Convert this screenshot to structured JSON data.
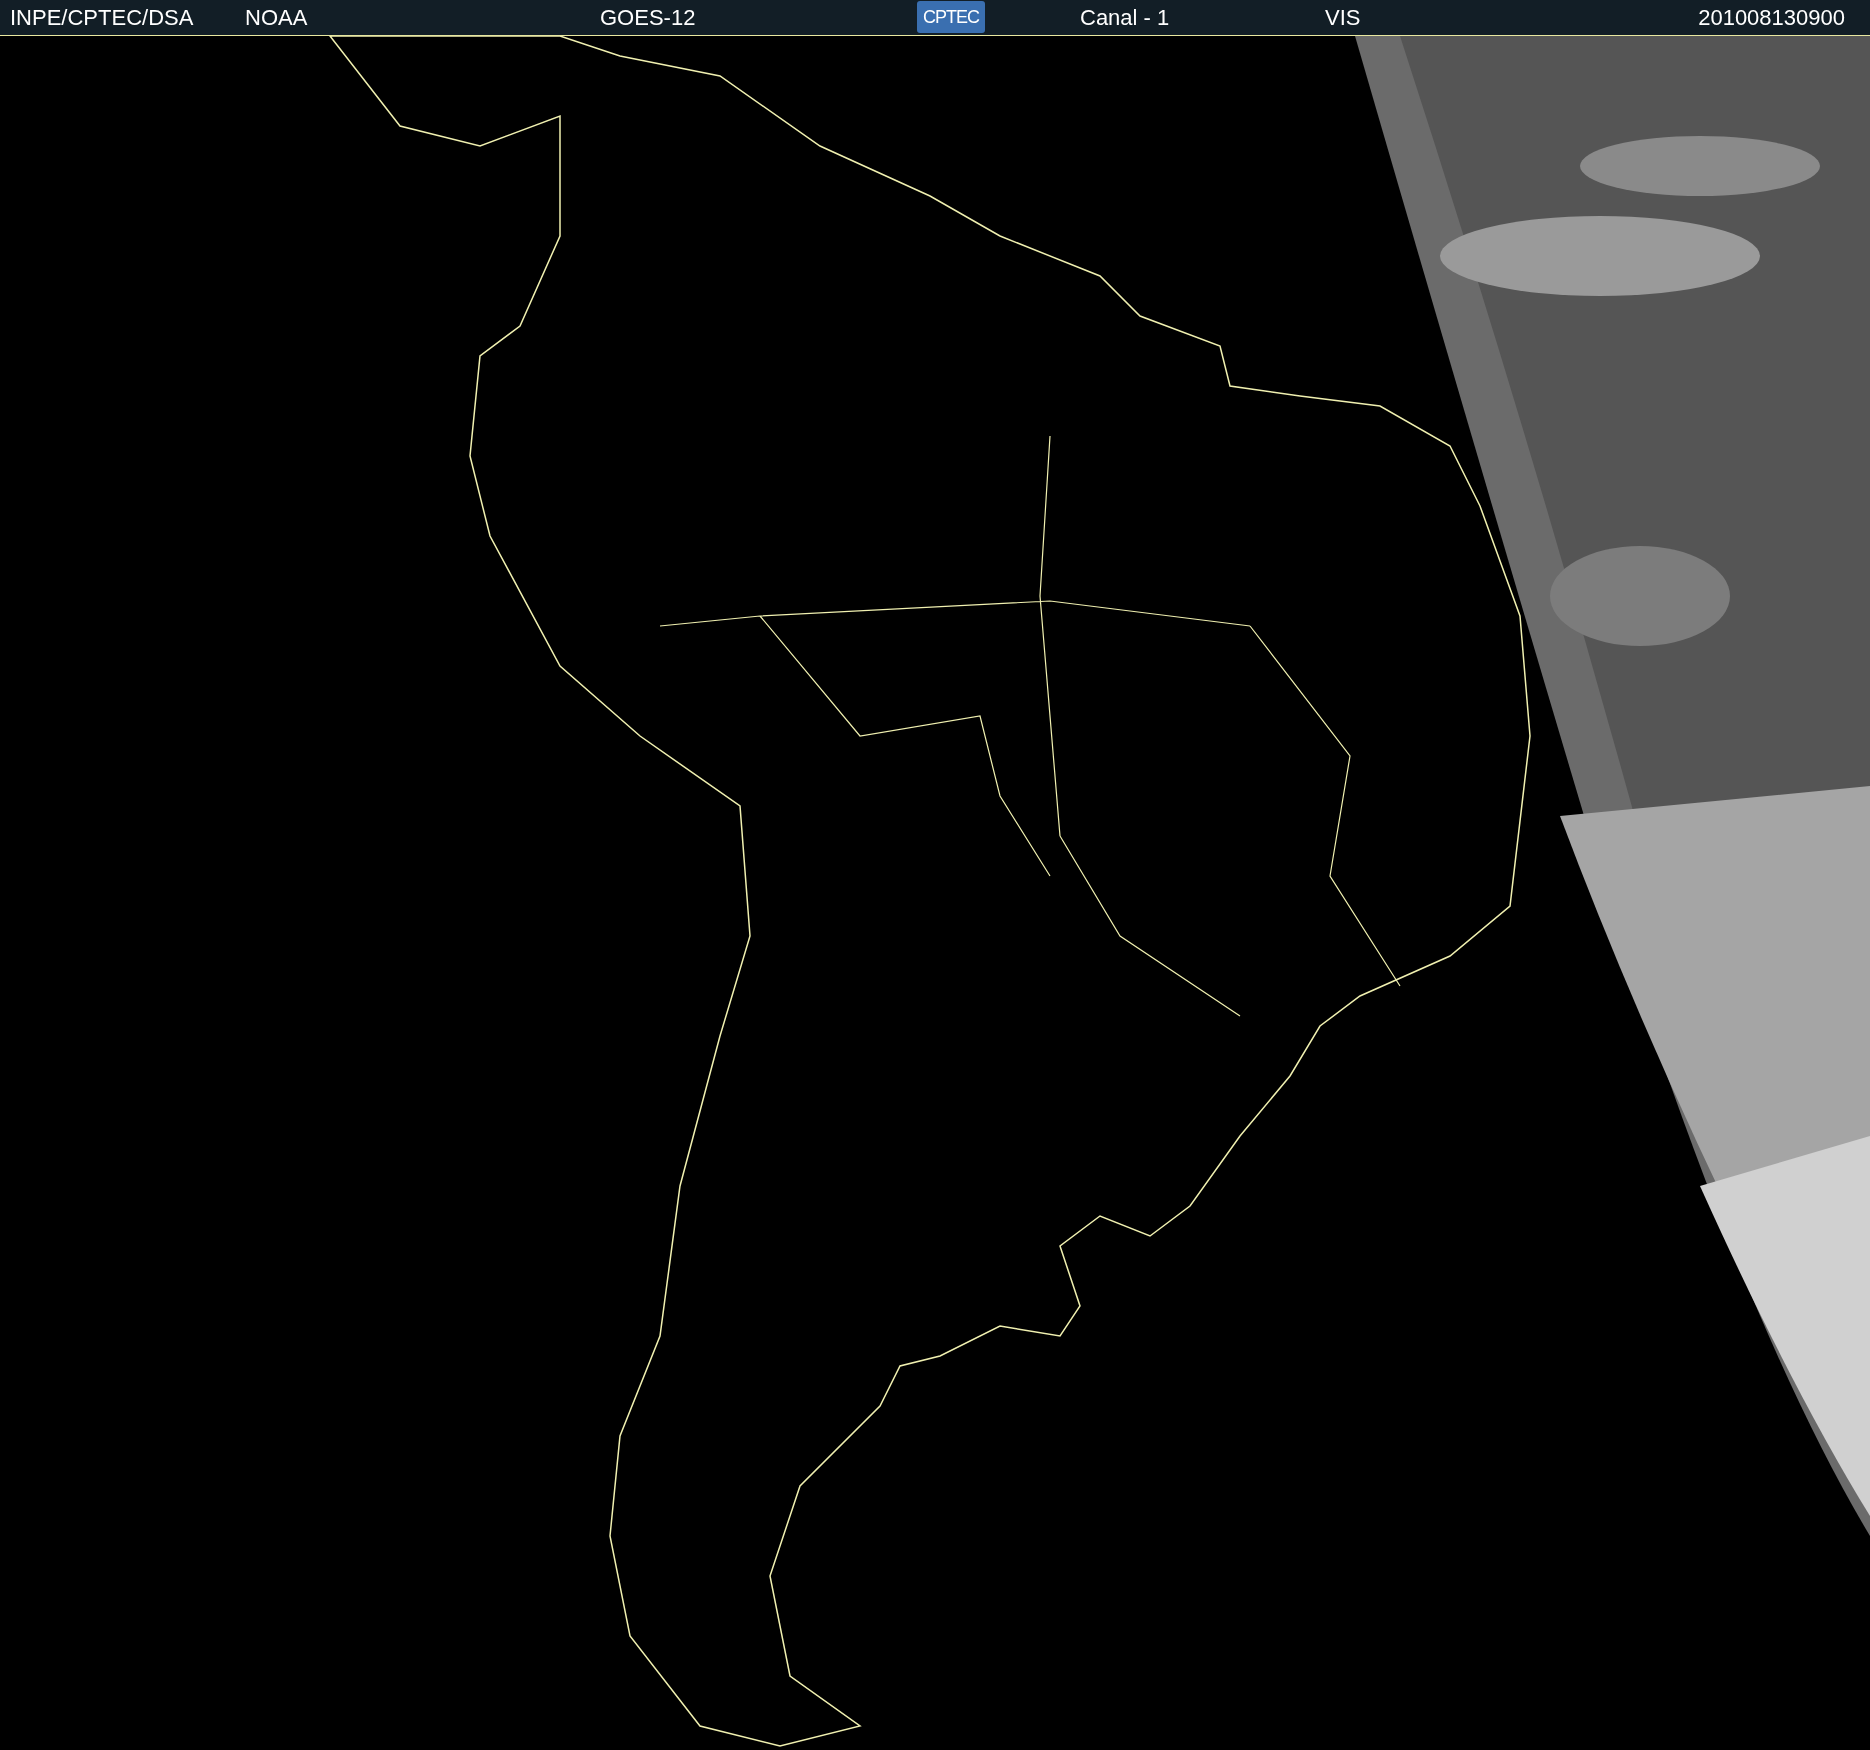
{
  "header": {
    "source": "INPE/CPTEC/DSA",
    "agency": "NOAA",
    "satellite": "GOES-12",
    "logo": "CPTEC",
    "channel": "Canal - 1",
    "band": "VIS",
    "timestamp": "201008130900"
  }
}
